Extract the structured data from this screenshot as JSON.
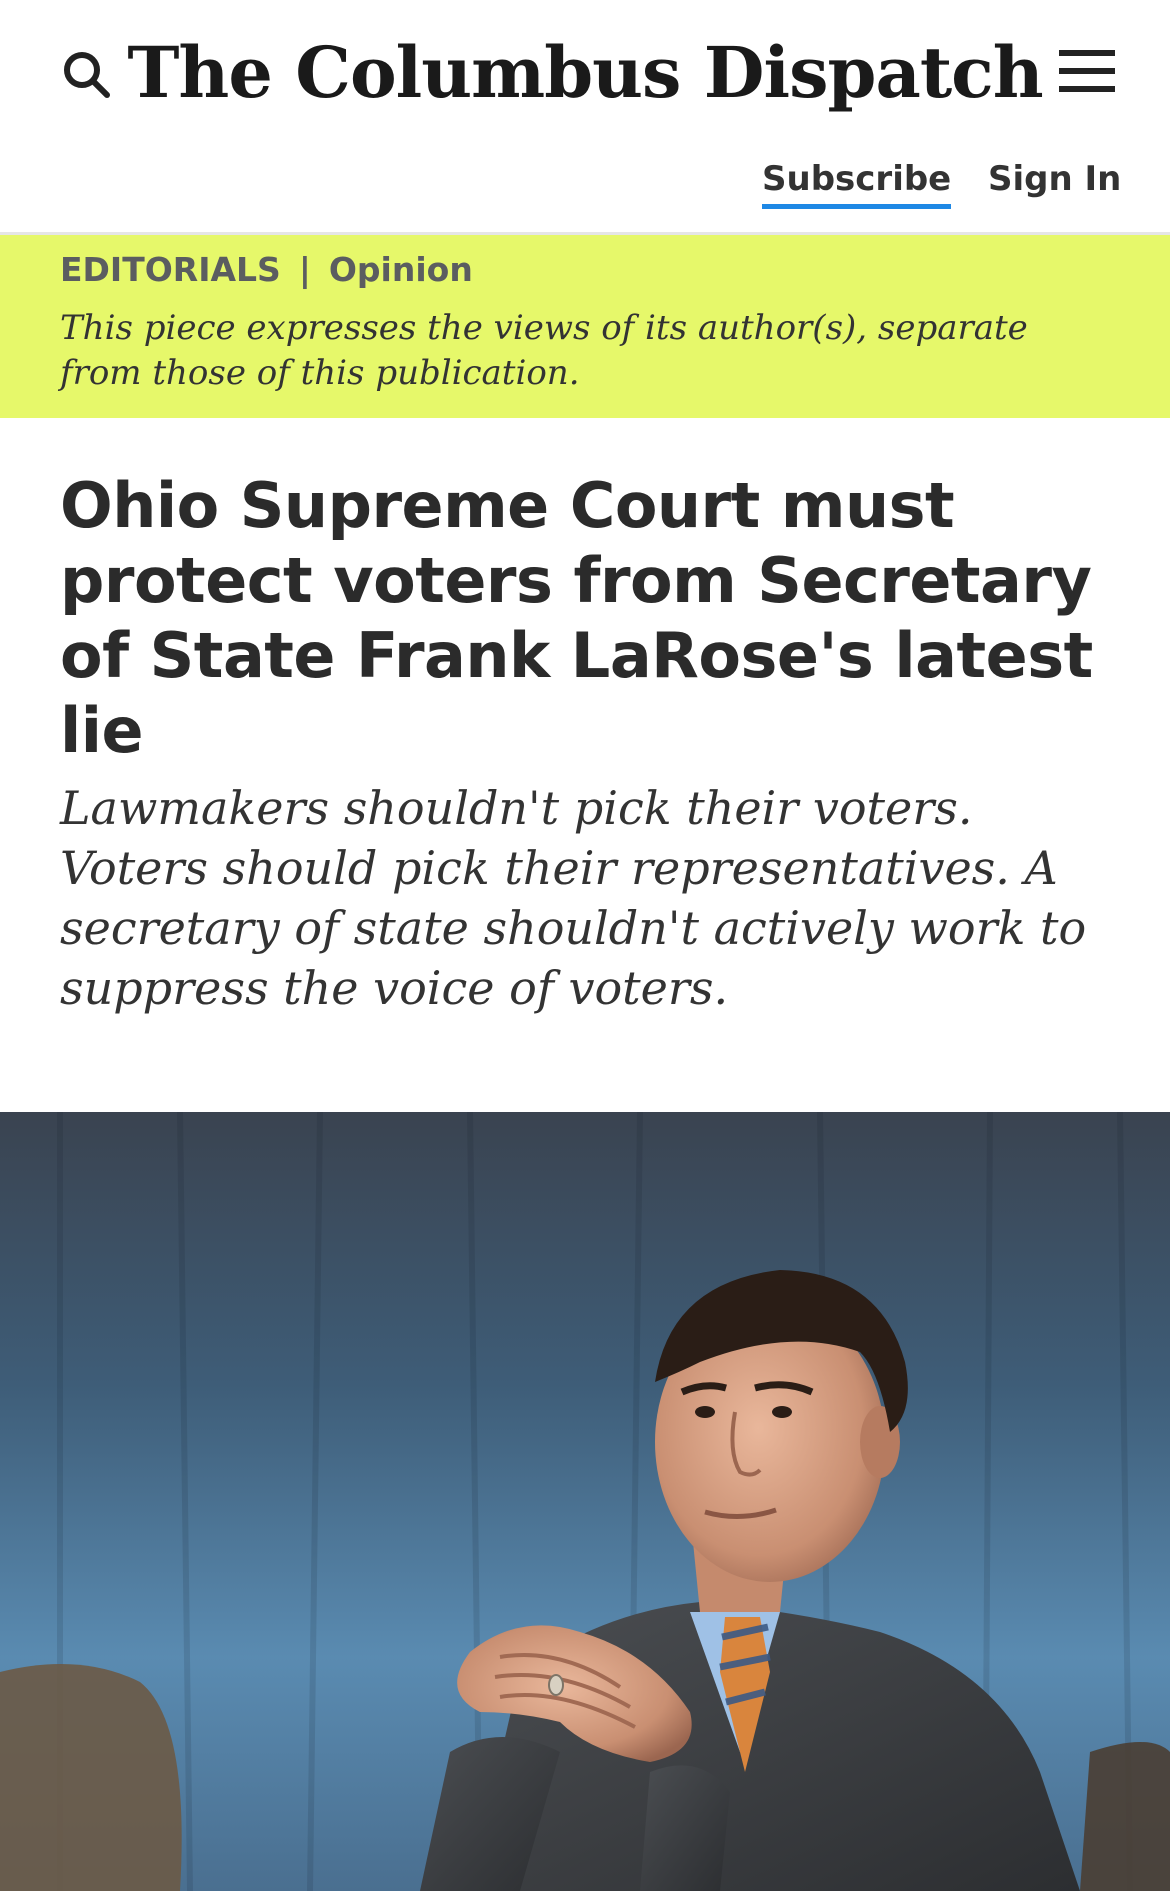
{
  "header": {
    "logo_text": "The Columbus Dispatch",
    "search_icon": "search-icon",
    "menu_icon": "hamburger-menu-icon",
    "subscribe_label": "Subscribe",
    "signin_label": "Sign In",
    "subscribe_underline_color": "#1e88e5"
  },
  "label_band": {
    "background_color": "#e6f86a",
    "section": "EDITORIALS",
    "separator": "|",
    "category": "Opinion",
    "disclaimer": "This piece expresses the views of its author(s), separate from those of this publication."
  },
  "article": {
    "headline": "Ohio Supreme Court must protect voters from Secretary of State Frank LaRose's latest lie",
    "dek": "Lawmakers shouldn't pick their voters. Voters should pick their representatives. A secretary of state shouldn't actively work to suppress the voice of voters."
  },
  "hero_image": {
    "subject": "man in suit with clasped hands"
  }
}
